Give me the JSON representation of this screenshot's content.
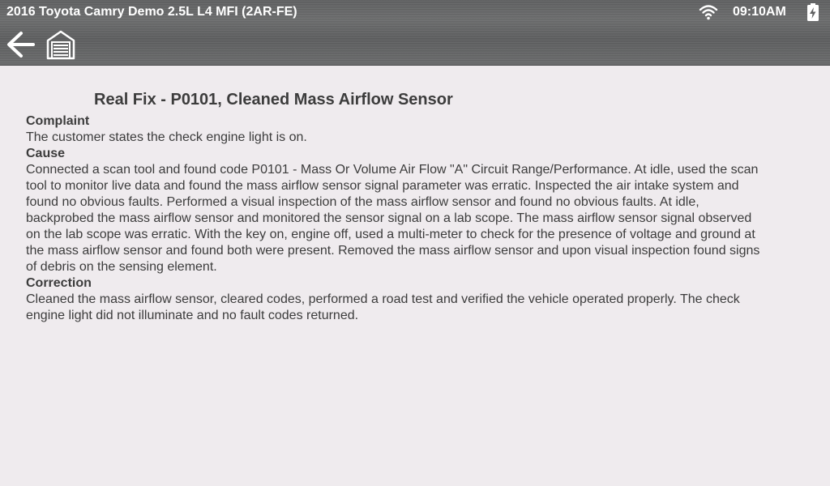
{
  "status_bar": {
    "vehicle_title": "2016 Toyota Camry Demo 2.5L L4 MFI (2AR-FE)",
    "time": "09:10AM",
    "wifi_icon": "wifi-icon",
    "battery_icon": "battery-charging-icon"
  },
  "nav": {
    "back_icon": "back-arrow-icon",
    "home_icon": "garage-home-icon"
  },
  "report": {
    "title": "Real Fix - P0101, Cleaned Mass Airflow Sensor",
    "sections": [
      {
        "heading": "Complaint",
        "body": "The customer states the check engine light is on."
      },
      {
        "heading": "Cause",
        "body": "Connected a scan tool and found code P0101 - Mass Or Volume Air Flow \"A\" Circuit Range/Performance. At idle, used the scan tool to monitor live data and found the mass airflow sensor signal parameter was erratic. Inspected the air intake system and found no obvious faults. Performed a visual inspection of the mass airflow sensor and found no obvious faults. At idle, backprobed the mass airflow sensor and monitored the sensor signal on a lab scope. The mass airflow sensor signal observed on the lab scope was erratic. With the key on, engine off, used a multi-meter to check for the presence of voltage and ground at the mass airflow sensor and found both were present. Removed the mass airflow sensor and upon visual inspection found signs of debris on the sensing element."
      },
      {
        "heading": "Correction",
        "body": "Cleaned the mass airflow sensor, cleared codes, performed a road test and verified the vehicle operated properly. The check engine light did not illuminate and no fault codes returned."
      }
    ]
  },
  "colors": {
    "header_bg": "#626364",
    "page_bg": "#efebee",
    "text": "#3c3c3c",
    "header_text": "#ffffff"
  }
}
